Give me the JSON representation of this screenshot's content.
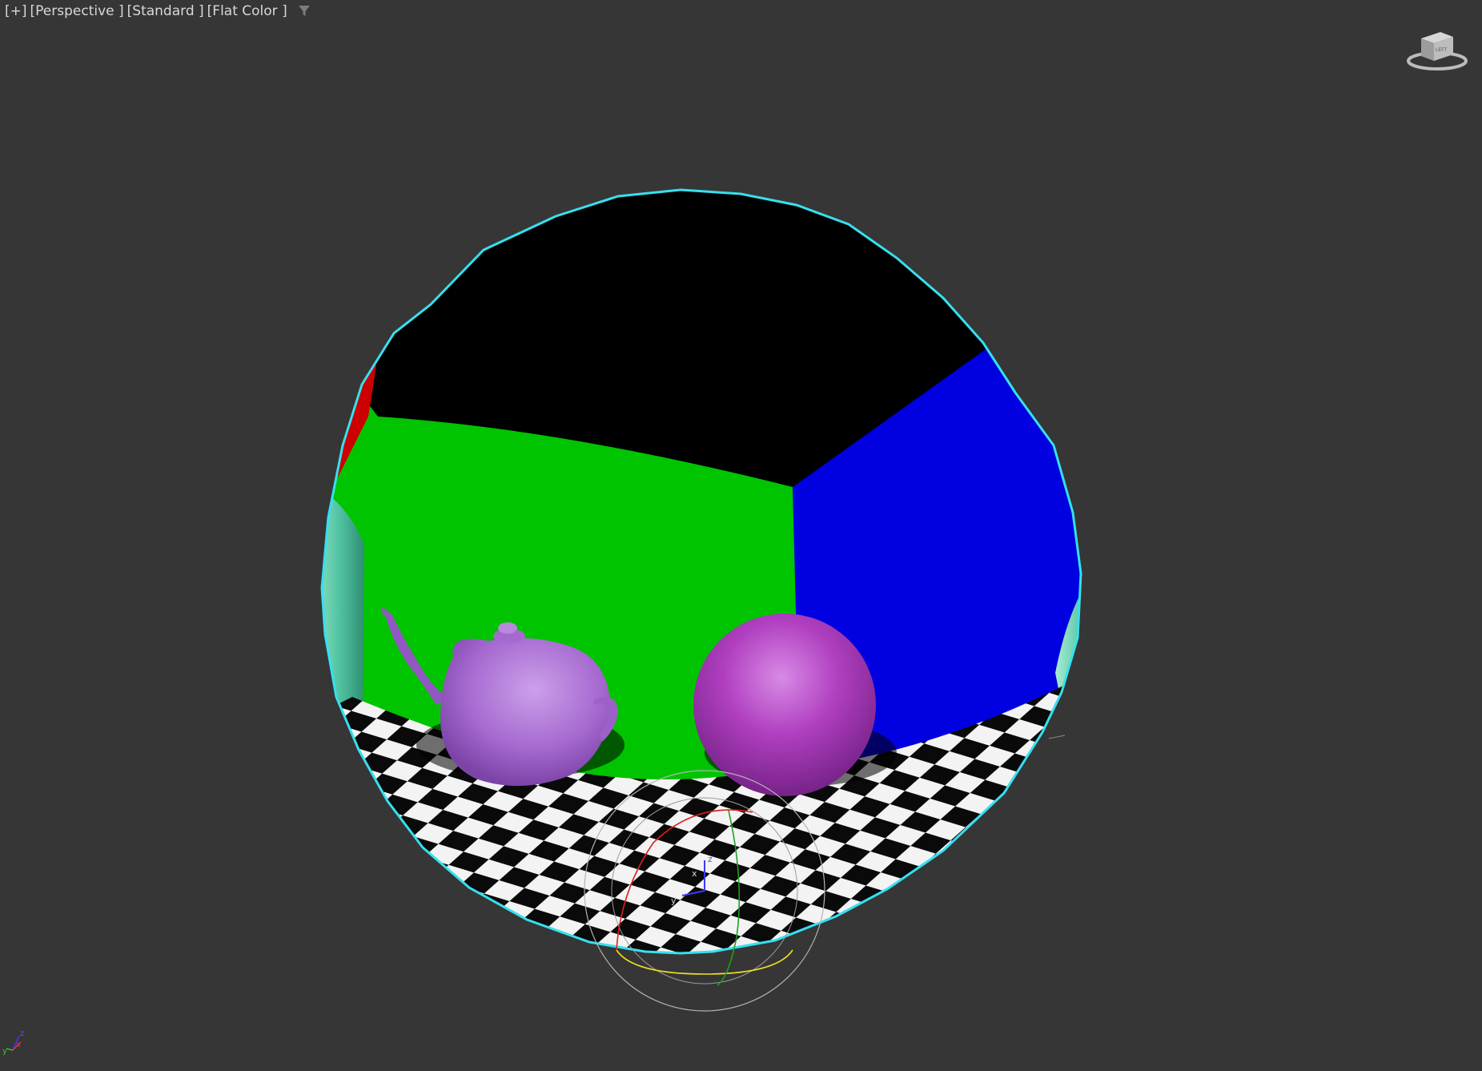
{
  "viewport": {
    "labels": {
      "plus": "[+]",
      "view": "[Perspective ]",
      "style": "[Standard ]",
      "shading": "[Flat Color ]"
    },
    "filter_icon": "filter-icon",
    "viewcube_face": "LEFT",
    "gizmo_axes": {
      "x": "x",
      "y": "y",
      "z": "z"
    },
    "tripod_axes": {
      "x": "x",
      "y": "y",
      "z": "z"
    },
    "colors": {
      "background": "#363636",
      "selection_outline": "#36e0ef",
      "green_wall": "#00c400",
      "blue_wall": "#0000e0",
      "black_ceiling": "#000000",
      "red_wall": "#cc0000",
      "teapot": "#a66ad0",
      "sphere": "#b03fc0"
    }
  }
}
